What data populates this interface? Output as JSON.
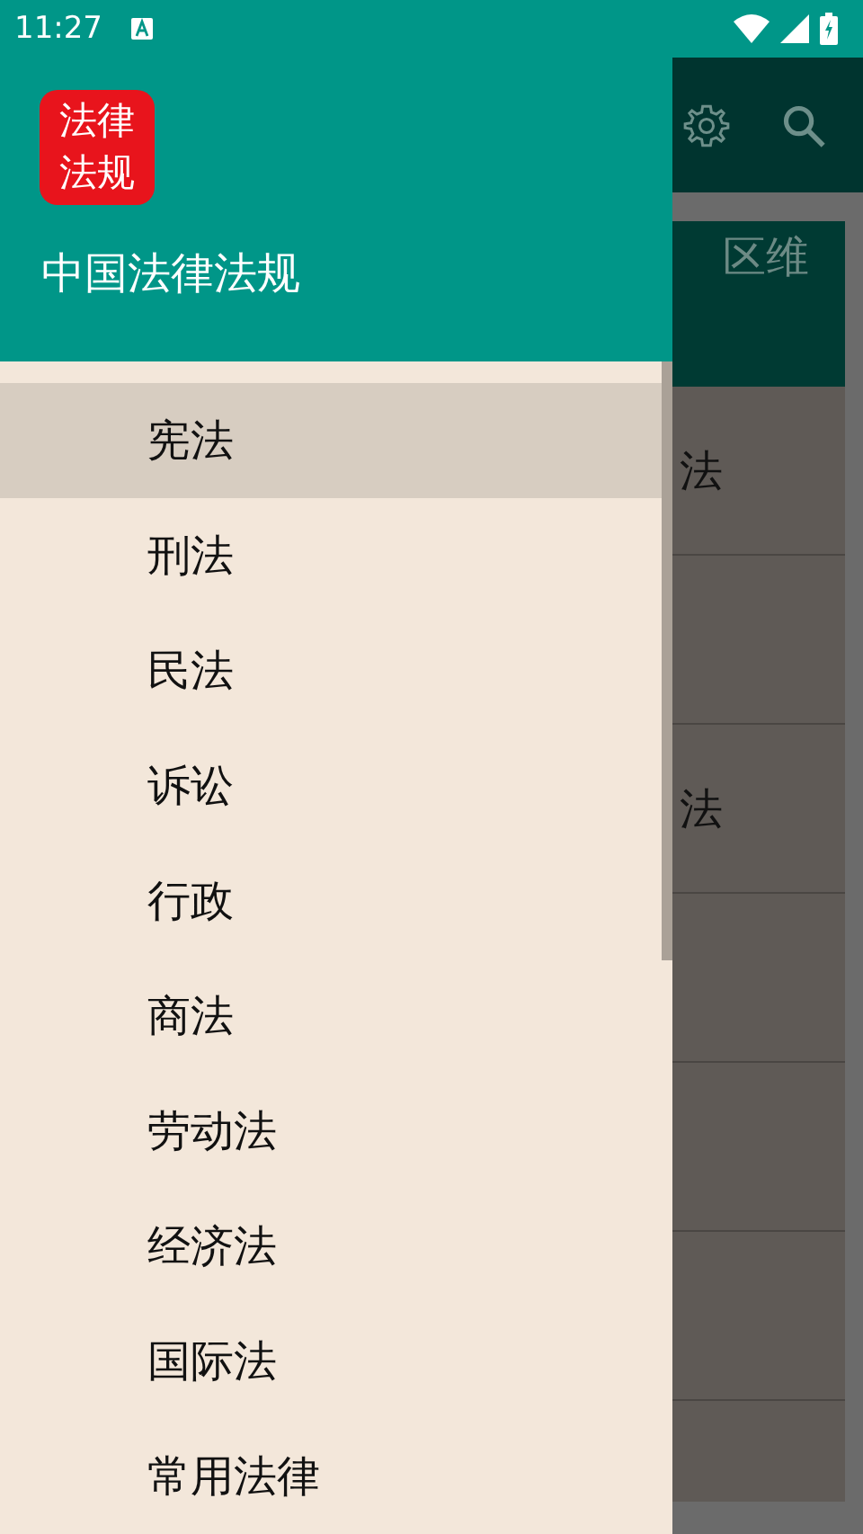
{
  "status_bar": {
    "time": "11:27"
  },
  "drawer": {
    "logo": {
      "line_1": "法律",
      "line_2": "法规"
    },
    "title": "中国法律法规",
    "items": [
      {
        "label": "宪法",
        "selected": true
      },
      {
        "label": "刑法",
        "selected": false
      },
      {
        "label": "民法",
        "selected": false
      },
      {
        "label": "诉讼",
        "selected": false
      },
      {
        "label": "行政",
        "selected": false
      },
      {
        "label": "商法",
        "selected": false
      },
      {
        "label": "劳动法",
        "selected": false
      },
      {
        "label": "经济法",
        "selected": false
      },
      {
        "label": "国际法",
        "selected": false
      },
      {
        "label": "常用法律",
        "selected": false
      }
    ]
  },
  "background": {
    "card_header": "区维",
    "rows": [
      {
        "kind": "text",
        "text": "法"
      },
      {
        "kind": "blank"
      },
      {
        "kind": "text",
        "text": "法"
      },
      {
        "kind": "blank"
      },
      {
        "kind": "blank"
      },
      {
        "kind": "blank"
      }
    ]
  }
}
